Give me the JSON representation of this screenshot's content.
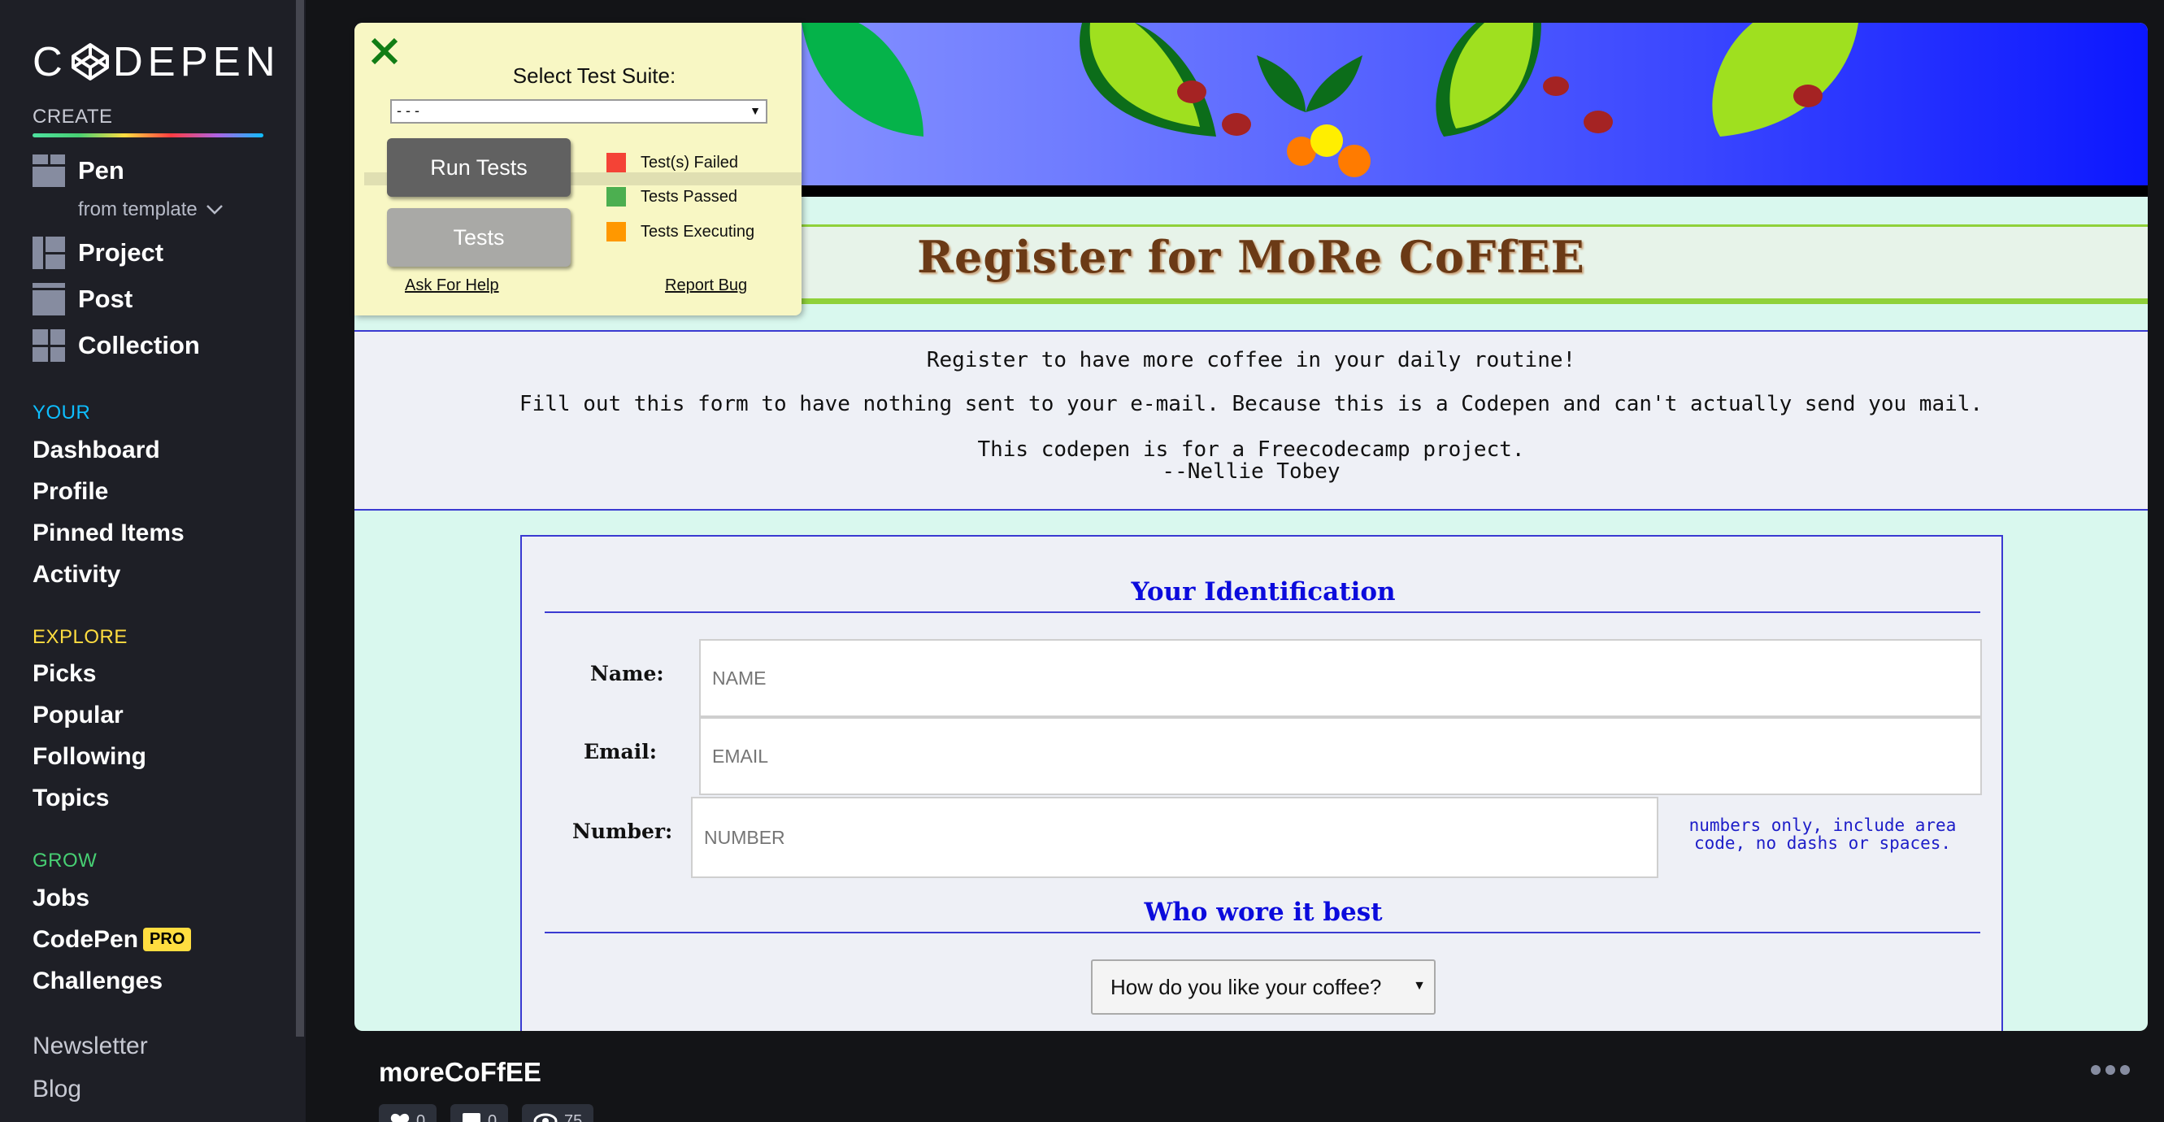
{
  "logo": {
    "text_left": "C",
    "text_right": "DEPEN"
  },
  "sidebar": {
    "create_label": "CREATE",
    "create_items": [
      {
        "label": "Pen",
        "icon": "pen-icon"
      },
      {
        "label": "Project",
        "icon": "project-icon"
      },
      {
        "label": "Post",
        "icon": "post-icon"
      },
      {
        "label": "Collection",
        "icon": "collection-icon"
      }
    ],
    "from_template": "from template",
    "your_label": "YOUR",
    "your_items": [
      "Dashboard",
      "Profile",
      "Pinned Items",
      "Activity"
    ],
    "explore_label": "EXPLORE",
    "explore_items": [
      "Picks",
      "Popular",
      "Following",
      "Topics"
    ],
    "grow_label": "GROW",
    "grow_items": [
      "Jobs",
      "CodePen",
      "Challenges"
    ],
    "pro_badge": "PRO",
    "footer_items": [
      "Newsletter",
      "Blog"
    ]
  },
  "colors": {
    "sidebar_bg": "#1e1f26",
    "page_bg": "#131417",
    "your_label": "#0ebeff",
    "explore_label": "#ffdd40",
    "grow_label": "#47cf73",
    "pro_badge": "#ffdd40"
  },
  "test_panel": {
    "suite_label": "Select Test Suite:",
    "suite_value": "- - -",
    "run_button": "Run Tests",
    "tests_button": "Tests",
    "legend": [
      {
        "label": "Test(s) Failed",
        "color": "#f44336"
      },
      {
        "label": "Tests Passed",
        "color": "#4caf50"
      },
      {
        "label": "Tests Executing",
        "color": "#ff9800"
      }
    ],
    "help_link": "Ask For Help",
    "bug_link": "Report Bug"
  },
  "preview": {
    "title": "Register for MoRe CoFfEE",
    "intro": [
      "Register to have more coffee in your daily routine!",
      "Fill out this form to have nothing sent to your e-mail. Because this is a Codepen and can't actually send you mail.",
      "This codepen is for a Freecodecamp project.",
      "--Nellie Tobey"
    ],
    "identification_legend": "Your Identification",
    "name_label": "Name:",
    "name_placeholder": "NAME",
    "email_label": "Email:",
    "email_placeholder": "EMAIL",
    "number_label": "Number:",
    "number_placeholder": "NUMBER",
    "number_hint": "numbers only, include area code, no dashs or spaces.",
    "wore_legend": "Who wore it best",
    "coffee_select": "How do you like your coffee?"
  },
  "pen": {
    "title": "moreCoFfEE",
    "stats": [
      {
        "icon": "heart-icon",
        "value": "0"
      },
      {
        "icon": "comment-icon",
        "value": "0"
      },
      {
        "icon": "eye-icon",
        "value": "75"
      }
    ]
  }
}
